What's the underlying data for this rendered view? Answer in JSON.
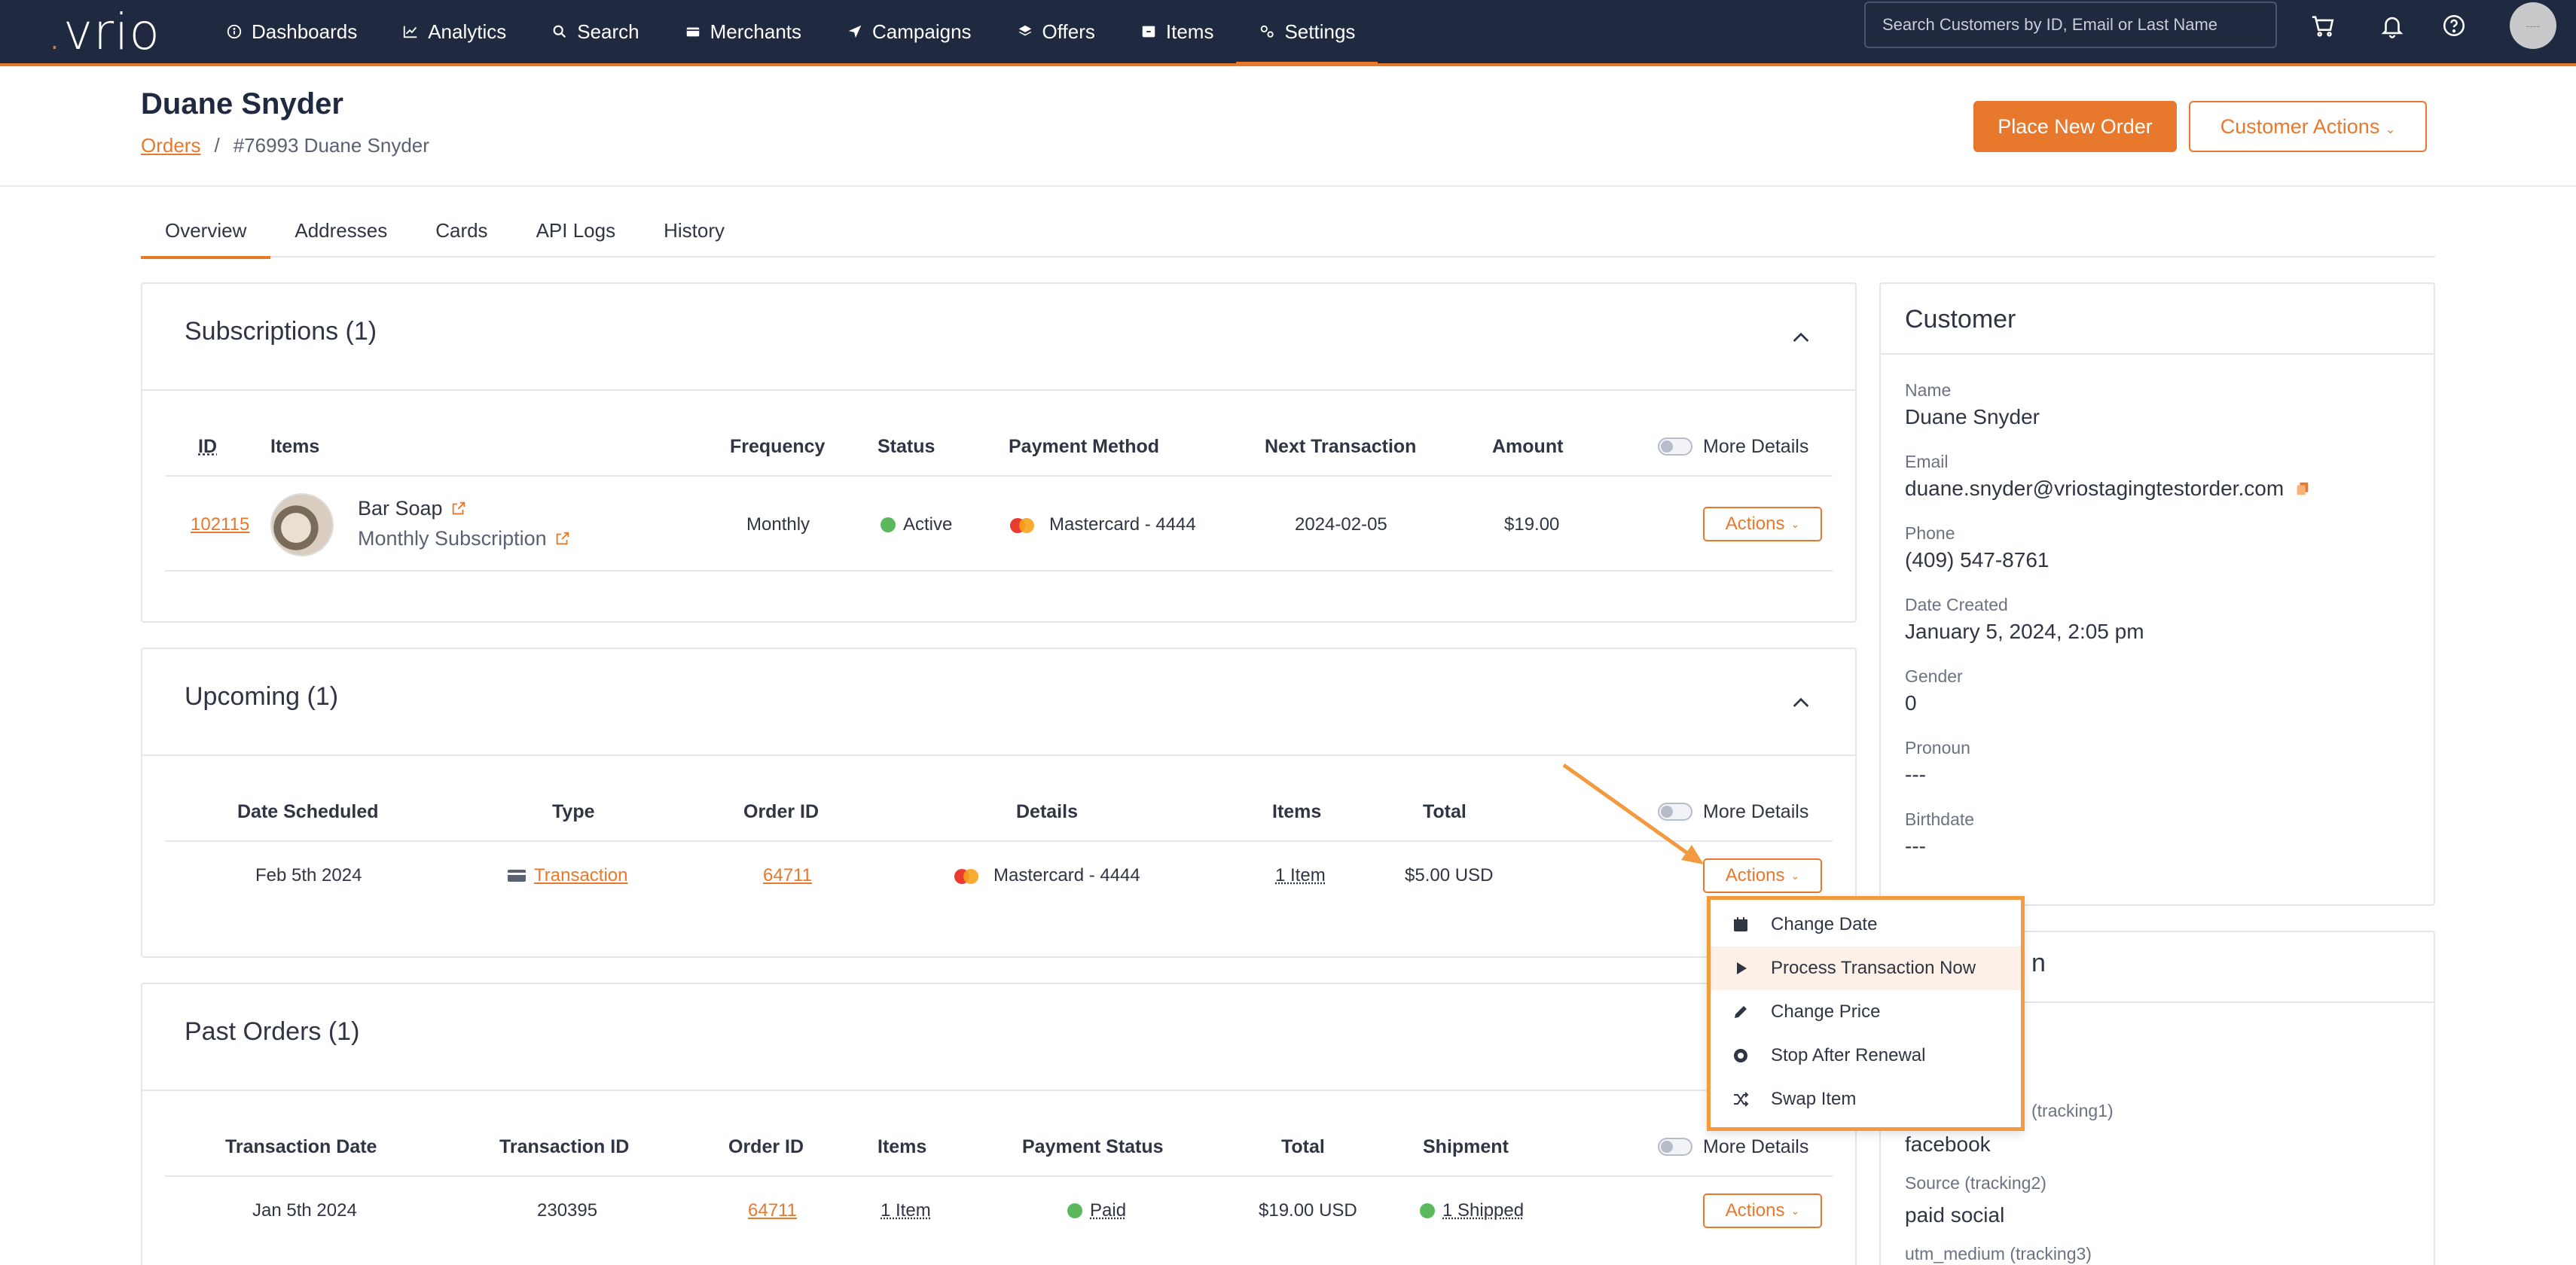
{
  "nav": {
    "logo": "vrio",
    "items": [
      {
        "label": "Dashboards",
        "icon": "info-icon"
      },
      {
        "label": "Analytics",
        "icon": "chart-icon"
      },
      {
        "label": "Search",
        "icon": "search-icon"
      },
      {
        "label": "Merchants",
        "icon": "wallet-icon"
      },
      {
        "label": "Campaigns",
        "icon": "send-icon"
      },
      {
        "label": "Offers",
        "icon": "layers-icon"
      },
      {
        "label": "Items",
        "icon": "box-icon"
      },
      {
        "label": "Settings",
        "icon": "gears-icon"
      }
    ],
    "active": "Settings",
    "search_placeholder": "Search Customers by ID, Email or Last Name",
    "avatar_text": "----"
  },
  "header": {
    "title": "Duane Snyder",
    "breadcrumb_link": "Orders",
    "breadcrumb_sep": "/",
    "breadcrumb_current": "#76993 Duane Snyder",
    "place_order": "Place New Order",
    "customer_actions": "Customer Actions"
  },
  "tabs": [
    "Overview",
    "Addresses",
    "Cards",
    "API Logs",
    "History"
  ],
  "subscriptions": {
    "title": "Subscriptions (1)",
    "columns": [
      "ID",
      "Items",
      "Frequency",
      "Status",
      "Payment Method",
      "Next Transaction",
      "Amount"
    ],
    "more_details": "More Details",
    "row": {
      "id": "102115",
      "item_name": "Bar Soap",
      "item_sub": "Monthly Subscription",
      "frequency": "Monthly",
      "status": "Active",
      "payment": "Mastercard - 4444",
      "next": "2024-02-05",
      "amount": "$19.00",
      "actions": "Actions"
    }
  },
  "upcoming": {
    "title": "Upcoming (1)",
    "columns": [
      "Date Scheduled",
      "Type",
      "Order ID",
      "Details",
      "Items",
      "Total"
    ],
    "more_details": "More Details",
    "row": {
      "date": "Feb 5th 2024",
      "type": "Transaction",
      "order_id": "64711",
      "details": "Mastercard - 4444",
      "items": "1 Item",
      "total": "$5.00 USD",
      "actions": "Actions"
    }
  },
  "dropdown": [
    {
      "label": "Change Date",
      "icon": "calendar-icon"
    },
    {
      "label": "Process Transaction Now",
      "icon": "play-icon"
    },
    {
      "label": "Change Price",
      "icon": "pencil-icon"
    },
    {
      "label": "Stop After Renewal",
      "icon": "stop-circle-icon"
    },
    {
      "label": "Swap Item",
      "icon": "shuffle-icon"
    }
  ],
  "past": {
    "title": "Past Orders (1)",
    "columns": [
      "Transaction Date",
      "Transaction ID",
      "Order ID",
      "Items",
      "Payment Status",
      "Total",
      "Shipment"
    ],
    "more_details": "More Details",
    "row": {
      "date": "Jan 5th 2024",
      "txn_id": "230395",
      "order_id": "64711",
      "items": "1 Item",
      "payment_status": "Paid",
      "total": "$19.00 USD",
      "shipment": "1 Shipped",
      "actions": "Actions"
    }
  },
  "customer": {
    "title": "Customer",
    "fields": [
      {
        "label": "Name",
        "value": "Duane Snyder"
      },
      {
        "label": "Email",
        "value": "duane.snyder@vriostagingtestorder.com"
      },
      {
        "label": "Phone",
        "value": "(409) 547-8761"
      },
      {
        "label": "Date Created",
        "value": "January 5, 2024, 2:05 pm"
      },
      {
        "label": "Gender",
        "value": "0"
      },
      {
        "label": "Pronoun",
        "value": "---"
      },
      {
        "label": "Birthdate",
        "value": "---"
      }
    ]
  },
  "tracking": {
    "title_fragment": "n",
    "fields": [
      {
        "label": "(tracking1)",
        "value": "facebook"
      },
      {
        "label": "Source (tracking2)",
        "value": "paid social"
      },
      {
        "label": "utm_medium (tracking3)",
        "value": ""
      }
    ]
  },
  "colors": {
    "accent": "#e8782c",
    "nav": "#1f2940",
    "active": "#5cb85c"
  }
}
